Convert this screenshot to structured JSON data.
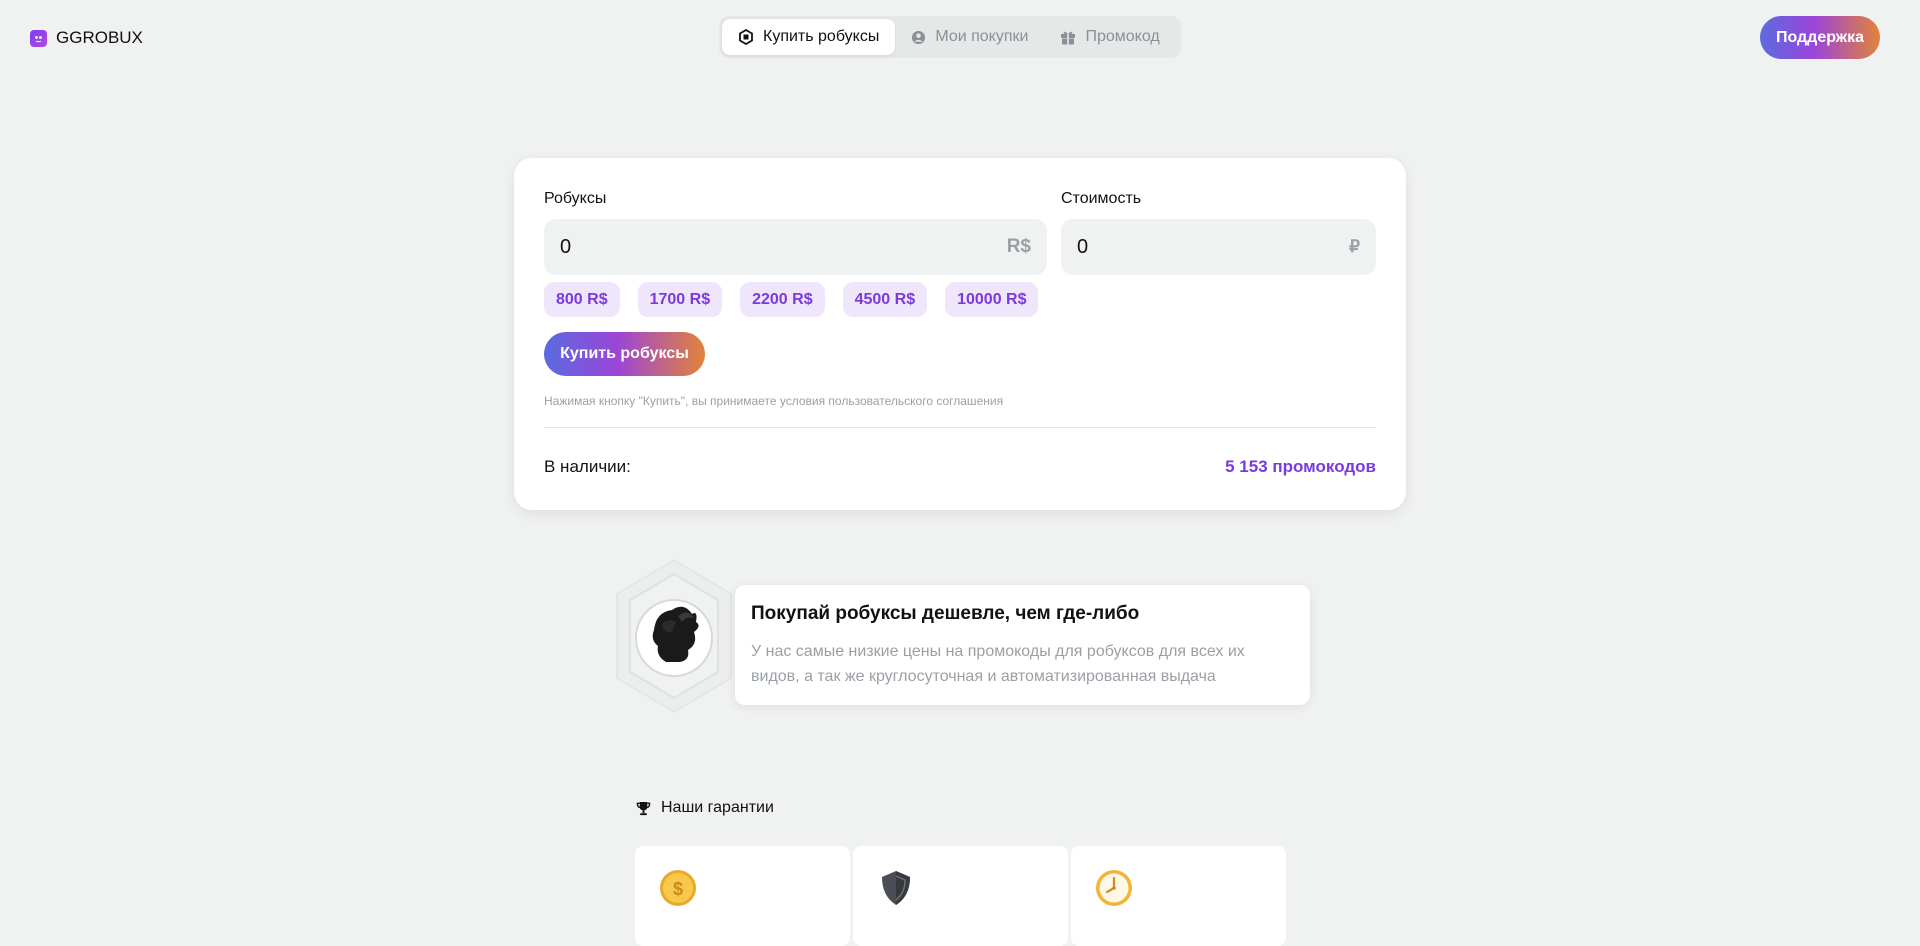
{
  "header": {
    "logo_text": "GGROBUX",
    "nav": [
      {
        "label": "Купить робуксы",
        "icon": "robux-icon",
        "active": true
      },
      {
        "label": "Мои покупки",
        "icon": "user-circle-icon",
        "active": false
      },
      {
        "label": "Промокод",
        "icon": "gift-icon",
        "active": false
      }
    ],
    "support_label": "Поддержка"
  },
  "purchase": {
    "robux_label": "Робуксы",
    "robux_value": "0",
    "robux_unit": "R$",
    "cost_label": "Стоимость",
    "cost_value": "0",
    "cost_unit": "₽",
    "presets": [
      "800 R$",
      "1700 R$",
      "2200 R$",
      "4500 R$",
      "10000 R$"
    ],
    "buy_label": "Купить робуксы",
    "terms": "Нажимая кнопку \"Купить\", вы принимаете условия пользовательского соглашения",
    "stock_label": "В наличии:",
    "stock_value": "5 153 промокодов"
  },
  "feature": {
    "title": "Покупай робуксы дешевле, чем где-либо",
    "text": "У нас самые низкие цены на промокоды для робуксов для всех их видов, а так же круглосуточная и автоматизированная выдача"
  },
  "guarantees": {
    "title": "Наши гарантии",
    "icons": [
      "coin-icon",
      "shield-icon",
      "clock-icon"
    ]
  },
  "colors": {
    "accent": "#7a3ae0",
    "chip_bg": "#efe6fb",
    "background": "#f0f1f1"
  }
}
